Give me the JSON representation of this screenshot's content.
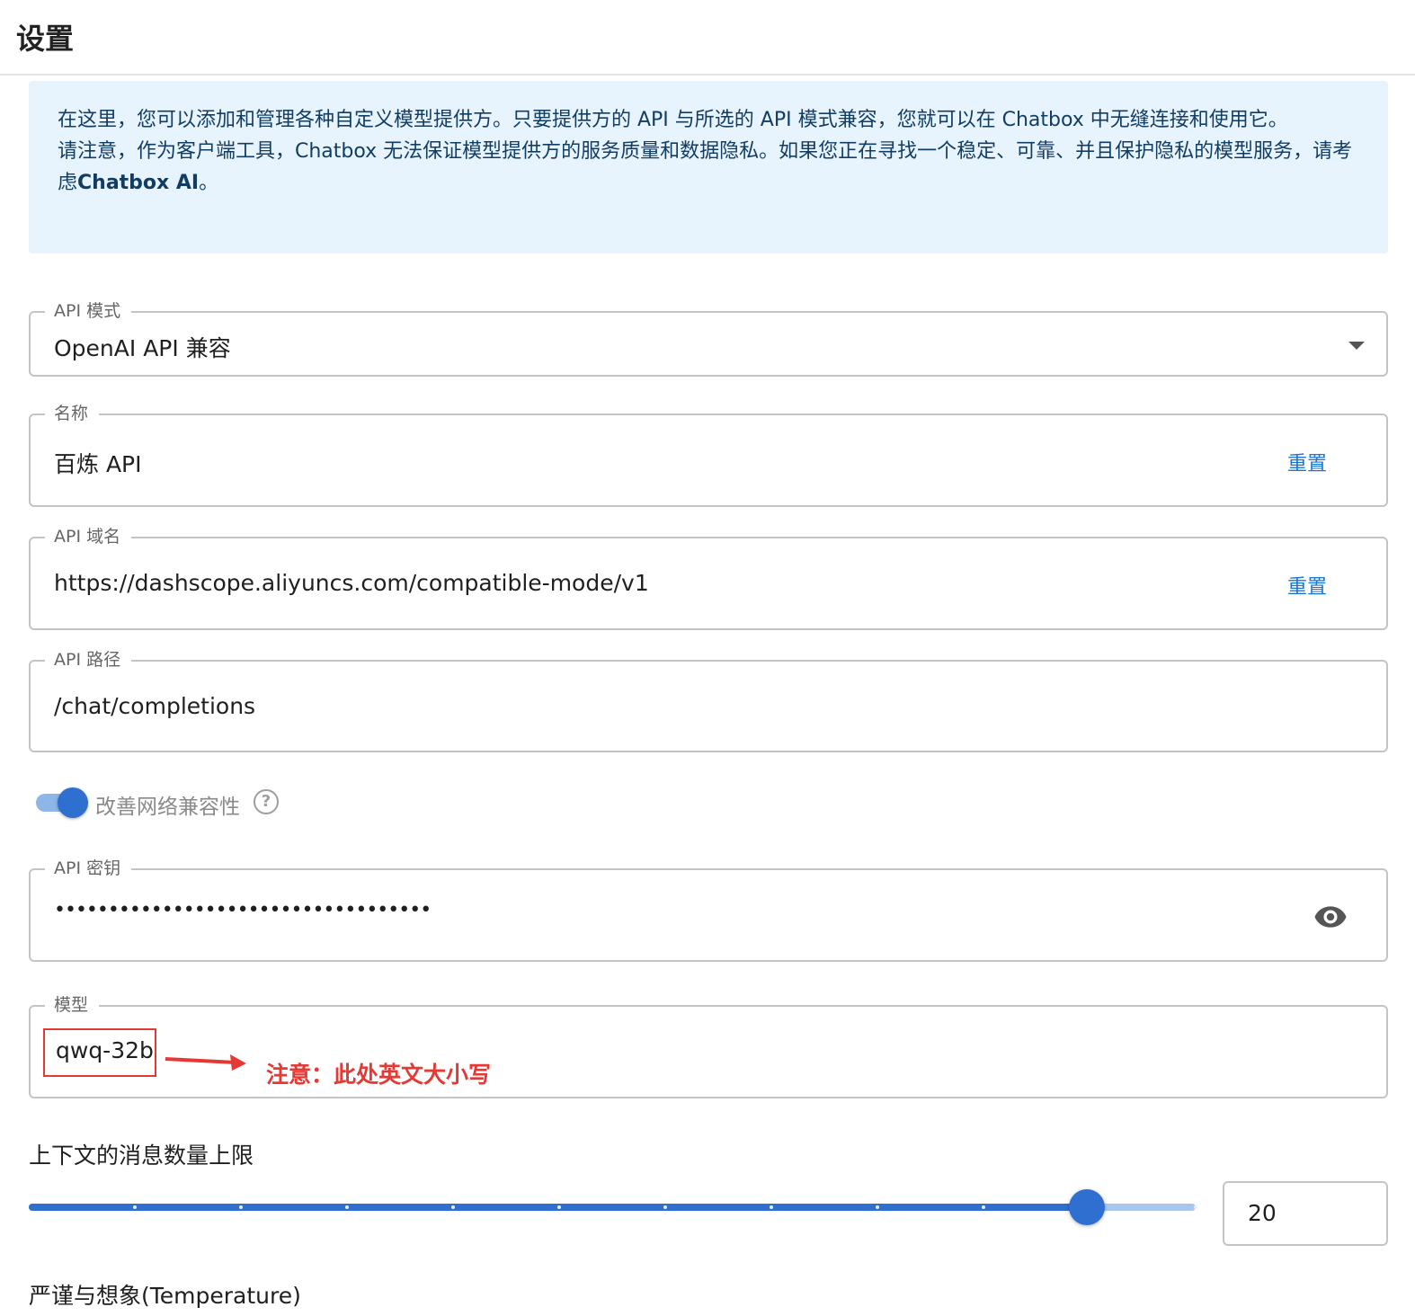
{
  "header": {
    "title": "设置"
  },
  "notice": {
    "text_1": "在这里，您可以添加和管理各种自定义模型提供方。只要提供方的 API 与所选的 API 模式兼容，您就可以在 Chatbox 中无缝连接和使用它。",
    "text_2": "请注意，作为客户端工具，Chatbox 无法保证模型提供方的服务质量和数据隐私。如果您正在寻找一个稳定、可靠、并且保护隐私的模型服务，请考虑",
    "link_text": "Chatbox AI",
    "text_end": "。"
  },
  "api_mode": {
    "label": "API 模式",
    "value": "OpenAI API 兼容"
  },
  "name_field": {
    "label": "名称",
    "value": "百炼 API",
    "reset_label": "重置"
  },
  "api_host": {
    "label": "API 域名",
    "value": "https://dashscope.aliyuncs.com/compatible-mode/v1",
    "reset_label": "重置"
  },
  "api_path": {
    "label": "API 路径",
    "value": "/chat/completions"
  },
  "network_compat": {
    "label": "改善网络兼容性",
    "enabled": true
  },
  "api_key": {
    "label": "API 密钥",
    "value": "•••••••••••••••••••••••••••••••••••"
  },
  "model": {
    "label": "模型",
    "value": "qwq-32b"
  },
  "annotation": {
    "text": "注意：此处英文大小写"
  },
  "context_limit": {
    "title": "上下文的消息数量上限",
    "value": "20",
    "slider_fraction": 0.907,
    "ticks": 11
  },
  "temperature": {
    "title": "严谨与想象(Temperature)"
  },
  "colors": {
    "accent": "#2f6fd0",
    "link": "#1976d2",
    "annotation": "#e53935",
    "notice_bg": "#e8f4fd"
  }
}
